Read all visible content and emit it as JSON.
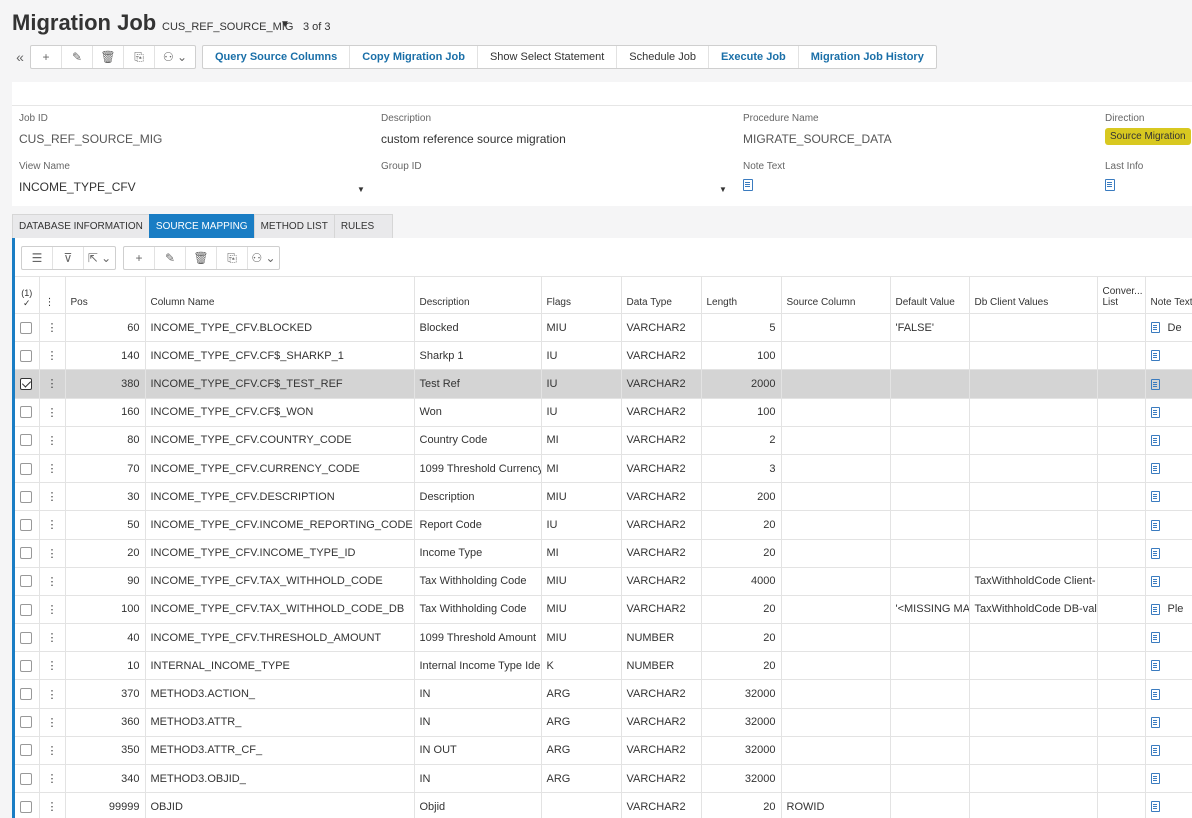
{
  "header": {
    "title": "Migration Job",
    "record_name": "CUS_REF_SOURCE_MIG",
    "record_count": "3 of 3"
  },
  "toolbar": {
    "actions": [
      "Query Source Columns",
      "Copy Migration Job",
      "Show Select Statement",
      "Schedule Job",
      "Execute Job",
      "Migration Job History"
    ]
  },
  "form": {
    "job_id_label": "Job ID",
    "job_id": "CUS_REF_SOURCE_MIG",
    "description_label": "Description",
    "description": "custom reference source migration",
    "procedure_label": "Procedure Name",
    "procedure": "MIGRATE_SOURCE_DATA",
    "direction_label": "Direction",
    "direction": "Source Migration",
    "view_label": "View Name",
    "view": "INCOME_TYPE_CFV",
    "group_label": "Group ID",
    "group": "",
    "note_label": "Note Text",
    "last_info_label": "Last Info",
    "accent_color": "#d8c820"
  },
  "tabs": [
    "DATABASE INFORMATION",
    "SOURCE MAPPING",
    "METHOD LIST",
    "RULES"
  ],
  "grid": {
    "selected_count": "(1)",
    "columns": {
      "pos": "Pos",
      "column_name": "Column Name",
      "description": "Description",
      "flags": "Flags",
      "data_type": "Data Type",
      "length": "Length",
      "source_column": "Source Column",
      "default_value": "Default Value",
      "db_client_values": "Db Client Values",
      "conver_list_1": "Conver...",
      "conver_list_2": "List",
      "note_text": "Note Text"
    },
    "rows": [
      {
        "pos": "60",
        "column": "INCOME_TYPE_CFV.BLOCKED",
        "desc": "Blocked",
        "flags": "MIU",
        "type": "VARCHAR2",
        "length": "5",
        "source": "",
        "default": "'FALSE'",
        "dbclient": "",
        "note": "De"
      },
      {
        "pos": "140",
        "column": "INCOME_TYPE_CFV.CF$_SHARKP_1",
        "desc": "Sharkp 1",
        "flags": "IU",
        "type": "VARCHAR2",
        "length": "100",
        "source": "",
        "default": "",
        "dbclient": "",
        "note": ""
      },
      {
        "pos": "380",
        "column": "INCOME_TYPE_CFV.CF$_TEST_REF",
        "desc": "Test Ref",
        "flags": "IU",
        "type": "VARCHAR2",
        "length": "2000",
        "source": "",
        "default": "",
        "dbclient": "",
        "note": ""
      },
      {
        "pos": "160",
        "column": "INCOME_TYPE_CFV.CF$_WON",
        "desc": "Won",
        "flags": "IU",
        "type": "VARCHAR2",
        "length": "100",
        "source": "",
        "default": "",
        "dbclient": "",
        "note": ""
      },
      {
        "pos": "80",
        "column": "INCOME_TYPE_CFV.COUNTRY_CODE",
        "desc": "Country Code",
        "flags": "MI",
        "type": "VARCHAR2",
        "length": "2",
        "source": "",
        "default": "",
        "dbclient": "",
        "note": ""
      },
      {
        "pos": "70",
        "column": "INCOME_TYPE_CFV.CURRENCY_CODE",
        "desc": "1099 Threshold Currency",
        "flags": "MI",
        "type": "VARCHAR2",
        "length": "3",
        "source": "",
        "default": "",
        "dbclient": "",
        "note": ""
      },
      {
        "pos": "30",
        "column": "INCOME_TYPE_CFV.DESCRIPTION",
        "desc": "Description",
        "flags": "MIU",
        "type": "VARCHAR2",
        "length": "200",
        "source": "",
        "default": "",
        "dbclient": "",
        "note": ""
      },
      {
        "pos": "50",
        "column": "INCOME_TYPE_CFV.INCOME_REPORTING_CODE",
        "desc": "Report Code",
        "flags": "IU",
        "type": "VARCHAR2",
        "length": "20",
        "source": "",
        "default": "",
        "dbclient": "",
        "note": ""
      },
      {
        "pos": "20",
        "column": "INCOME_TYPE_CFV.INCOME_TYPE_ID",
        "desc": "Income Type",
        "flags": "MI",
        "type": "VARCHAR2",
        "length": "20",
        "source": "",
        "default": "",
        "dbclient": "",
        "note": ""
      },
      {
        "pos": "90",
        "column": "INCOME_TYPE_CFV.TAX_WITHHOLD_CODE",
        "desc": "Tax Withholding Code",
        "flags": "MIU",
        "type": "VARCHAR2",
        "length": "4000",
        "source": "",
        "default": "",
        "dbclient": "TaxWithholdCode Client-",
        "note": ""
      },
      {
        "pos": "100",
        "column": "INCOME_TYPE_CFV.TAX_WITHHOLD_CODE_DB",
        "desc": "Tax Withholding Code",
        "flags": "MIU",
        "type": "VARCHAR2",
        "length": "20",
        "source": "",
        "default": "'<MISSING MAI",
        "dbclient": "TaxWithholdCode DB-val",
        "note": "Ple"
      },
      {
        "pos": "40",
        "column": "INCOME_TYPE_CFV.THRESHOLD_AMOUNT",
        "desc": "1099 Threshold Amount",
        "flags": "MIU",
        "type": "NUMBER",
        "length": "20",
        "source": "",
        "default": "",
        "dbclient": "",
        "note": ""
      },
      {
        "pos": "10",
        "column": "INTERNAL_INCOME_TYPE",
        "desc": "Internal Income Type Ide",
        "flags": "K",
        "type": "NUMBER",
        "length": "20",
        "source": "",
        "default": "",
        "dbclient": "",
        "note": ""
      },
      {
        "pos": "370",
        "column": "METHOD3.ACTION_",
        "desc": "IN",
        "flags": "ARG",
        "type": "VARCHAR2",
        "length": "32000",
        "source": "",
        "default": "",
        "dbclient": "",
        "note": ""
      },
      {
        "pos": "360",
        "column": "METHOD3.ATTR_",
        "desc": "IN",
        "flags": "ARG",
        "type": "VARCHAR2",
        "length": "32000",
        "source": "",
        "default": "",
        "dbclient": "",
        "note": ""
      },
      {
        "pos": "350",
        "column": "METHOD3.ATTR_CF_",
        "desc": "IN OUT",
        "flags": "ARG",
        "type": "VARCHAR2",
        "length": "32000",
        "source": "",
        "default": "",
        "dbclient": "",
        "note": ""
      },
      {
        "pos": "340",
        "column": "METHOD3.OBJID_",
        "desc": "IN",
        "flags": "ARG",
        "type": "VARCHAR2",
        "length": "32000",
        "source": "",
        "default": "",
        "dbclient": "",
        "note": ""
      },
      {
        "pos": "99999",
        "column": "OBJID",
        "desc": "Objid",
        "flags": "",
        "type": "VARCHAR2",
        "length": "20",
        "source": "ROWID",
        "default": "",
        "dbclient": "",
        "note": ""
      }
    ]
  }
}
